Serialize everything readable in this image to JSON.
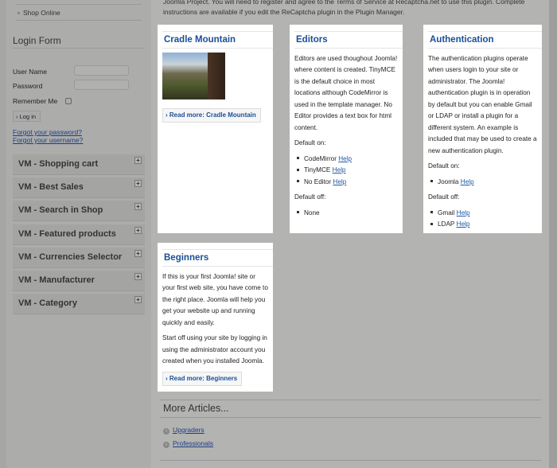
{
  "sidebar": {
    "menu_item": "Shop Online",
    "login": {
      "title": "Login Form",
      "username_label": "User Name",
      "password_label": "Password",
      "username_value": "",
      "password_value": "",
      "remember_label": "Remember Me",
      "login_button": "Log in",
      "forgot_password": "Forgot your password?",
      "forgot_username": "Forgot your username?"
    },
    "modules": [
      "VM - Shopping cart",
      "VM - Best Sales",
      "VM - Search in Shop",
      "VM - Featured products",
      "VM - Currencies Selector",
      "VM - Manufacturer",
      "VM - Category"
    ]
  },
  "intro": "Joomla Project. You will need to register and agree to the Terms of Service at Recaptcha.net to use this plugin. Complete instructions are available if you edit the ReCaptcha plugin in the Plugin Manager.",
  "cards": {
    "cradle": {
      "title": "Cradle Mountain",
      "readmore": "Read more: Cradle Mountain"
    },
    "editors": {
      "title": "Editors",
      "body": "Editors are used thoughout Joomla! where content is created. TinyMCE is the default choice in most locations although CodeMirror is used in the template manager. No Editor provides a text box for html content.",
      "default_on": "Default on:",
      "on_items": [
        "CodeMirror",
        "TinyMCE",
        "No Editor"
      ],
      "help": "Help",
      "default_off": "Default off:",
      "off_items": [
        "None"
      ]
    },
    "auth": {
      "title": "Authentication",
      "body": "The authentication plugins operate when users login to your site or administrator. The Joomla! authentication plugin is in operation by default but you can enable Gmail or LDAP or install a plugin for a different system. An example is included that may be used to create a new authentication plugin.",
      "default_on": "Default on:",
      "on_items": [
        "Joomla"
      ],
      "default_off": "Default off:",
      "off_items": [
        "Gmail",
        "LDAP"
      ],
      "help": "Help"
    },
    "beginners": {
      "title": "Beginners",
      "p1": "If this is your first Joomla! site or your first web site, you have come to the right place. Joomla will help you get your website up and running quickly and easily.",
      "p2": "Start off using your site by logging in using the administrator account you created when you installed Joomla.",
      "readmore": "Read more: Beginners"
    }
  },
  "more_articles": {
    "title": "More Articles...",
    "links": [
      "Upgraders",
      "Professionals"
    ]
  }
}
